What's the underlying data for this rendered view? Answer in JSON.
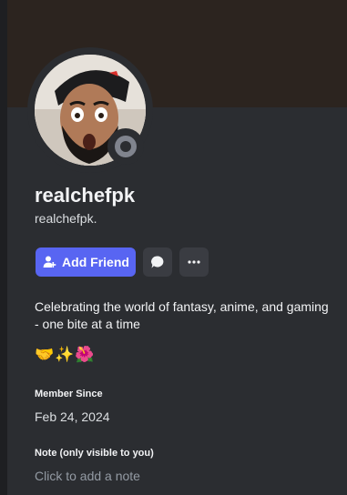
{
  "profile": {
    "display_name": "realchefpk",
    "username": "realchefpk.",
    "status": "offline",
    "bio": "Celebrating the world of fantasy, anime, and gaming - one bite at a time",
    "emojis": "🤝✨🌺"
  },
  "actions": {
    "add_friend_label": "Add Friend",
    "message_icon": "chat-bubble-icon",
    "more_icon": "more-options-icon"
  },
  "member_since": {
    "label": "Member Since",
    "value": "Feb 24, 2024"
  },
  "note": {
    "label": "Note (only visible to you)",
    "placeholder": "Click to add a note"
  },
  "colors": {
    "accent": "#5865f2",
    "card_bg": "#2b2d31",
    "banner_bg": "#2c241f",
    "status_offline": "#80848e"
  }
}
